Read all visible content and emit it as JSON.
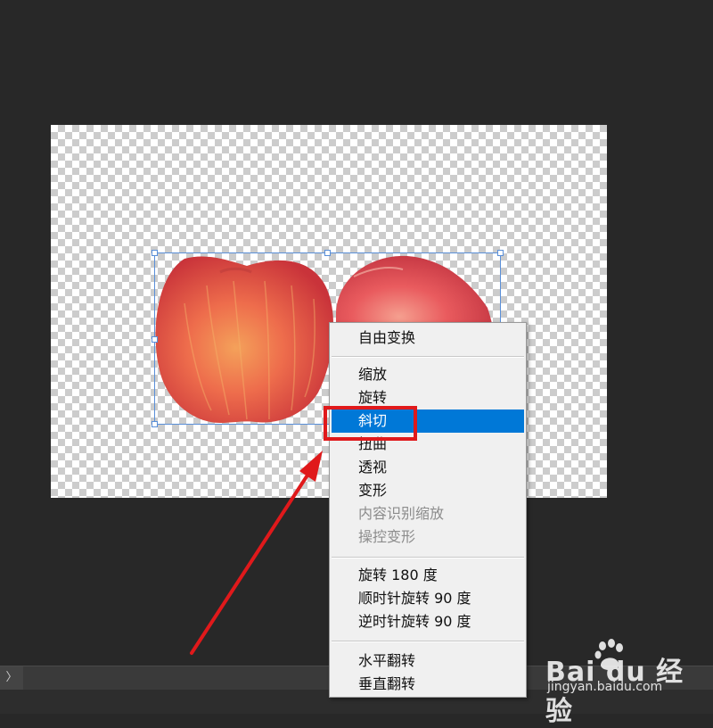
{
  "menu": {
    "items": [
      {
        "label": "自由变换",
        "disabled": false
      },
      {
        "label": "缩放",
        "disabled": false
      },
      {
        "label": "旋转",
        "disabled": false
      },
      {
        "label": "斜切",
        "disabled": false,
        "highlighted": true
      },
      {
        "label": "扭曲",
        "disabled": false
      },
      {
        "label": "透视",
        "disabled": false
      },
      {
        "label": "变形",
        "disabled": false
      },
      {
        "label": "内容识别缩放",
        "disabled": true
      },
      {
        "label": "操控变形",
        "disabled": true
      },
      {
        "label": "旋转 180 度",
        "disabled": false
      },
      {
        "label": "顺时针旋转 90 度",
        "disabled": false
      },
      {
        "label": "逆时针旋转 90 度",
        "disabled": false
      },
      {
        "label": "水平翻转",
        "disabled": false
      },
      {
        "label": "垂直翻转",
        "disabled": false
      }
    ]
  },
  "bottom_bar": {
    "chevron": "〉"
  },
  "watermark": {
    "logo": "Bai du 经验",
    "url": "jingyan.baidu.com"
  },
  "colors": {
    "highlight": "#0078d7",
    "annotation_red": "#e0191b",
    "workspace": "#282828"
  },
  "icons": {
    "collapse": "chevron-right-icon",
    "watermark_paw": "paw-icon"
  }
}
